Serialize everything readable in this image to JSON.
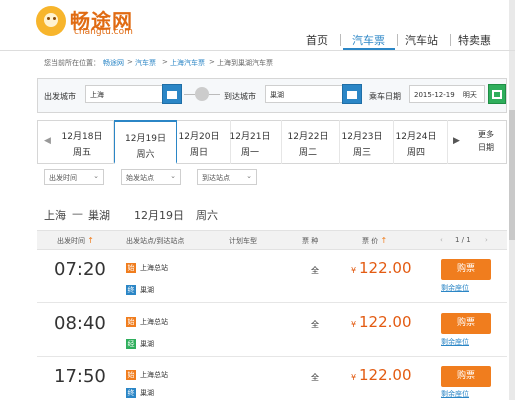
{
  "header": {
    "logo_main": "畅途网",
    "logo_sub": "changtu.com",
    "nav": [
      "首页",
      "汽车票",
      "汽车站",
      "特卖惠"
    ],
    "nav_active_index": 1
  },
  "breadcrumb": {
    "prefix": "您当前所在位置：",
    "items": [
      "畅途网",
      "汽车票",
      "上海汽车票",
      "上海到巢湖汽车票"
    ],
    "separator": ">"
  },
  "search": {
    "from_label": "出发城市",
    "from_value": "上海",
    "to_label": "到达城市",
    "to_value": "巢湖",
    "date_label": "乘车日期",
    "date_value": "2015-12-19",
    "date_note": "明天"
  },
  "date_tabs": {
    "tabs": [
      {
        "date": "12月18日",
        "weekday": "周五"
      },
      {
        "date": "12月19日",
        "weekday": "周六"
      },
      {
        "date": "12月20日",
        "weekday": "周日"
      },
      {
        "date": "12月21日",
        "weekday": "周一"
      },
      {
        "date": "12月22日",
        "weekday": "周二"
      },
      {
        "date": "12月23日",
        "weekday": "周三"
      },
      {
        "date": "12月24日",
        "weekday": "周四"
      }
    ],
    "active_index": 1,
    "more_line1": "更多",
    "more_line2": "日期"
  },
  "filters": [
    "出发时间",
    "始发站点",
    "到达站点"
  ],
  "route_heading": {
    "from": "上海",
    "dash": "—",
    "to": "巢湖",
    "date": "12月19日",
    "weekday": "周六"
  },
  "table": {
    "headers": [
      "出发时间",
      "出发站点/到达站点",
      "计划车型",
      "票 种",
      "票 价"
    ],
    "pager": "1 / 1",
    "rows": [
      {
        "time": "07:20",
        "from_tag": "始",
        "from": "上海总站",
        "to_tag": "终",
        "to": "巢湖",
        "ticket_type": "全",
        "currency": "¥",
        "price": "122.00",
        "buy_label": "购票",
        "remain_label": "剩余座位"
      },
      {
        "time": "08:40",
        "from_tag": "始",
        "from": "上海总站",
        "to_tag": "经",
        "to": "巢湖",
        "ticket_type": "全",
        "currency": "¥",
        "price": "122.00",
        "buy_label": "购票",
        "remain_label": "剩余座位"
      },
      {
        "time": "17:50",
        "from_tag": "始",
        "from": "上海总站",
        "to_tag": "终",
        "to": "巢湖",
        "ticket_type": "全",
        "currency": "¥",
        "price": "122.00",
        "buy_label": "购票",
        "remain_label": "剩余座位"
      }
    ]
  },
  "colors": {
    "brand_orange": "#f07d1e",
    "link_blue": "#2b86c6",
    "price_red": "#e35b12"
  }
}
